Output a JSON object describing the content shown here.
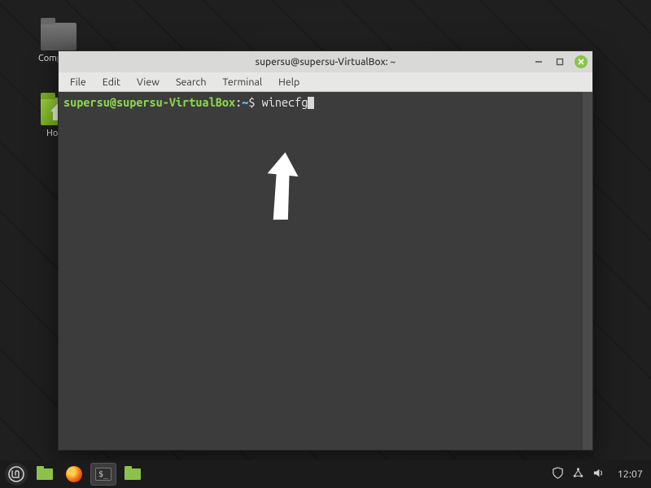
{
  "desktop": {
    "icons": [
      {
        "label": "Computer"
      },
      {
        "label": "Home"
      }
    ]
  },
  "terminal_window": {
    "title": "supersu@supersu-VirtualBox: ~",
    "controls": {
      "minimize": "–",
      "maximize": "❐",
      "close": "✕"
    },
    "menubar": [
      "File",
      "Edit",
      "View",
      "Search",
      "Terminal",
      "Help"
    ],
    "prompt": {
      "user_host": "supersu@supersu-VirtualBox",
      "separator": ":",
      "path": "~",
      "symbol": "$"
    },
    "command": "winecfg"
  },
  "taskbar": {
    "clock": "12:07",
    "pinned": [
      {
        "name": "start-menu"
      },
      {
        "name": "files"
      },
      {
        "name": "firefox"
      },
      {
        "name": "terminal",
        "active": true
      },
      {
        "name": "files-2"
      }
    ],
    "tray_icons": [
      "shield-icon",
      "network-icon",
      "volume-icon"
    ]
  }
}
